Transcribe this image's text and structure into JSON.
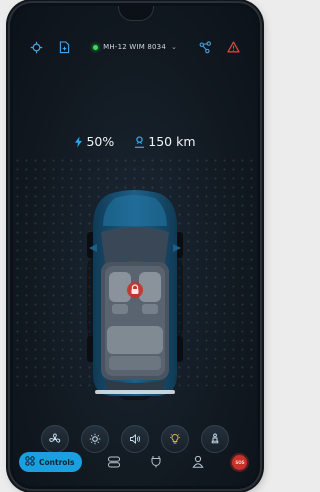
{
  "topbar": {
    "vehicle_plate": "MH-12 WIM 8034",
    "connection_color": "#3adb5a",
    "left_icons": [
      "location-target-icon",
      "doc-add-icon"
    ],
    "right_icons": [
      "share-nodes-icon",
      "alert-icon"
    ]
  },
  "stats": {
    "battery": "50%",
    "range": "150 km"
  },
  "car": {
    "lock_state": "locked",
    "lock_icon": "lock-icon",
    "body_color": "#1d5f86"
  },
  "quick_actions": [
    "fan-icon",
    "sun-icon",
    "horn-icon",
    "bulb-icon",
    "seat-person-icon"
  ],
  "bottom_nav": {
    "controls_label": "Controls",
    "items": [
      "controls-grid-icon",
      "cars-icon",
      "charging-plug-icon",
      "profile-icon"
    ],
    "sos_label": "SOS"
  },
  "colors": {
    "accent": "#1a9fe0",
    "sos": "#c8322a"
  }
}
